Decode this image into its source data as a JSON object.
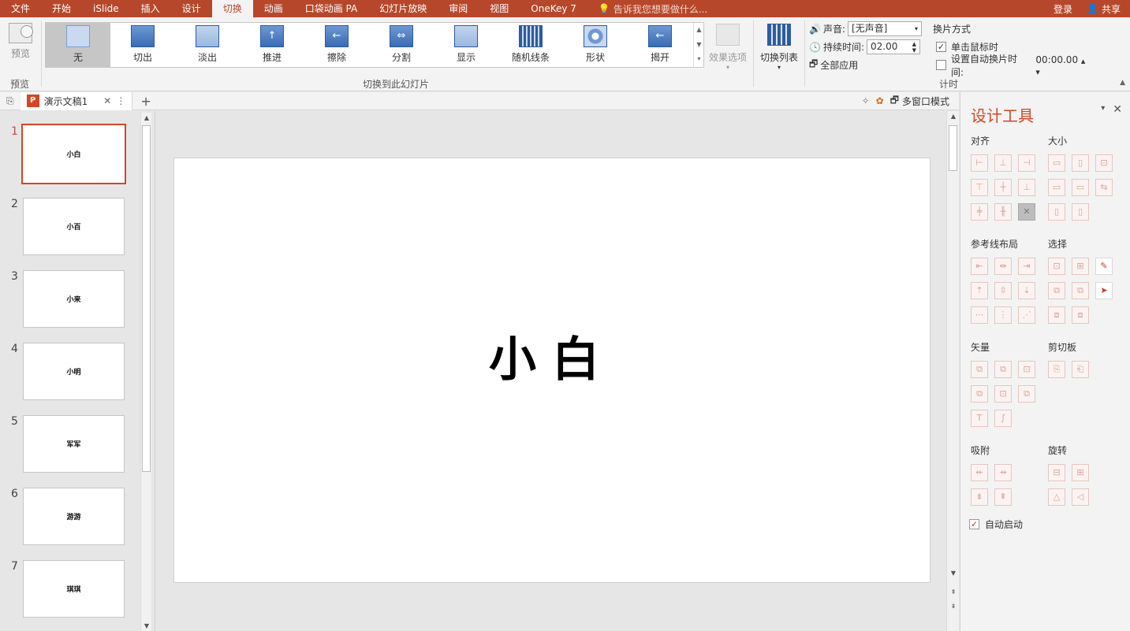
{
  "menu": {
    "tabs": [
      "文件",
      "开始",
      "iSlide",
      "插入",
      "设计",
      "切换",
      "动画",
      "口袋动画 PA",
      "幻灯片放映",
      "审阅",
      "视图",
      "OneKey 7"
    ],
    "active_tab": "切换",
    "tell_me": "告诉我您想要做什么...",
    "login": "登录",
    "share": "共享"
  },
  "ribbon": {
    "preview_label": "预览",
    "preview_group": "预览",
    "transitions": [
      {
        "label": "无",
        "thumb": "none"
      },
      {
        "label": "切出",
        "thumb": "solid"
      },
      {
        "label": "淡出",
        "thumb": "light"
      },
      {
        "label": "推进",
        "thumb": "arrow-up"
      },
      {
        "label": "擦除",
        "thumb": "arrow-left"
      },
      {
        "label": "分割",
        "thumb": "split"
      },
      {
        "label": "显示",
        "thumb": "light"
      },
      {
        "label": "随机线条",
        "thumb": "stripes"
      },
      {
        "label": "形状",
        "thumb": "circle"
      },
      {
        "label": "揭开",
        "thumb": "arrow-left"
      }
    ],
    "transitions_group": "切换到此幻灯片",
    "effect_options": "效果选项",
    "transition_list": "切换列表",
    "sound_label": "声音:",
    "sound_value": "[无声音]",
    "duration_label": "持续时间:",
    "duration_value": "02.00",
    "apply_all": "全部应用",
    "advance_title": "换片方式",
    "on_click_label": "单击鼠标时",
    "on_click_checked": true,
    "auto_after_label": "设置自动换片时间:",
    "auto_after_checked": false,
    "auto_after_value": "00:00.00",
    "timing_group": "计时"
  },
  "filebar": {
    "doc_name": "演示文稿1",
    "multi_window": "多窗口模式"
  },
  "slides": [
    {
      "num": "1",
      "text": "小白"
    },
    {
      "num": "2",
      "text": "小百"
    },
    {
      "num": "3",
      "text": "小来"
    },
    {
      "num": "4",
      "text": "小明"
    },
    {
      "num": "5",
      "text": "军军"
    },
    {
      "num": "6",
      "text": "游游"
    },
    {
      "num": "7",
      "text": "琪琪"
    }
  ],
  "active_slide": 0,
  "main_slide": {
    "title": "小白"
  },
  "pane": {
    "title": "设计工具",
    "sections": {
      "align": "对齐",
      "size": "大小",
      "guides": "参考线布局",
      "select": "选择",
      "vector": "矢量",
      "clipboard": "剪切板",
      "snap": "吸附",
      "rotate": "旋转"
    },
    "auto_start_label": "自动启动",
    "auto_start_checked": true
  },
  "colors": {
    "accent": "#b7472a",
    "pane_title": "#d24726",
    "active_border": "#d24726"
  }
}
